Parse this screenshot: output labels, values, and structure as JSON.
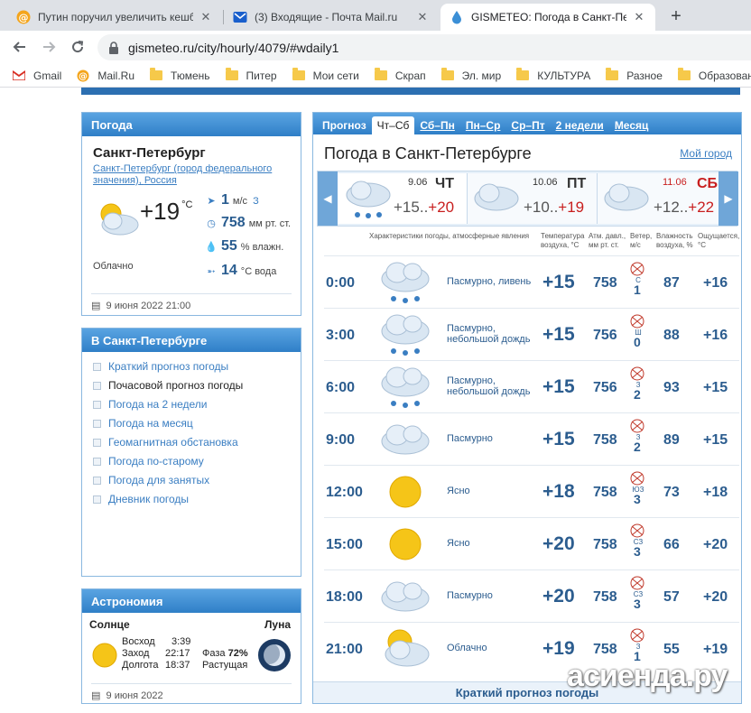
{
  "browser": {
    "tabs": [
      {
        "title": "Путин поручил увеличить кешб",
        "icon": "mailru-at-icon"
      },
      {
        "title": "(3) Входящие - Почта Mail.ru",
        "icon": "mail-envelope-icon"
      },
      {
        "title": "GISMETEO: Погода в Санкт-Пете",
        "icon": "gismeteo-drop-icon"
      }
    ],
    "url": "gismeteo.ru/city/hourly/4079/#wdaily1",
    "bookmarks": [
      "Gmail",
      "Mail.Ru",
      "Тюмень",
      "Питер",
      "Мои сети",
      "Скрап",
      "Эл. мир",
      "КУЛЬТУРА",
      "Разное",
      "Образован"
    ]
  },
  "weather_panel": {
    "title": "Погода",
    "city": "Санкт-Петербург",
    "region_link": "Санкт-Петербург (город федерального значения)",
    "country_link": "Россия",
    "temp": "+19",
    "temp_unit": "°C",
    "wind_value": "1",
    "wind_unit": "м/с",
    "wind_dir": "З",
    "pressure_value": "758",
    "pressure_unit": "мм рт. ст.",
    "humidity_value": "55",
    "humidity_unit": "% влажн.",
    "water_value": "14",
    "water_unit": "°С вода",
    "condition": "Облачно",
    "datetime": "9 июня 2022 21:00"
  },
  "city_menu": {
    "title": "В Санкт-Петербурге",
    "items": [
      "Краткий прогноз погоды",
      "Почасовой прогноз погоды",
      "Погода на 2 недели",
      "Погода на месяц",
      "Геомагнитная обстановка",
      "Погода по-старому",
      "Погода для занятых",
      "Дневник погоды"
    ]
  },
  "astronomy": {
    "title": "Астрономия",
    "sun_label": "Солнце",
    "moon_label": "Луна",
    "sunrise_label": "Восход",
    "sunrise": "3:39",
    "sunset_label": "Заход",
    "sunset": "22:17",
    "daylength_label": "Долгота",
    "daylength": "18:37",
    "phase_label": "Фаза",
    "phase": "72%",
    "moon_state": "Растущая",
    "date": "9 июня 2022"
  },
  "forecast": {
    "tabs": [
      "Прогноз",
      "Чт–Сб",
      "Сб–Пн",
      "Пн–Ср",
      "Ср–Пт",
      "2 недели",
      "Месяц"
    ],
    "title": "Погода в Санкт-Петербурге",
    "my_city": "Мой город",
    "days": [
      {
        "date": "9.06",
        "dow": "ЧТ",
        "lo": "+15",
        "hi": "+20"
      },
      {
        "date": "10.06",
        "dow": "ПТ",
        "lo": "+10",
        "hi": "+19"
      },
      {
        "date": "11.06",
        "dow": "СБ",
        "lo": "+12",
        "hi": "+22"
      }
    ],
    "columns": {
      "desc": "Характеристики погоды, атмосферные явления",
      "temp": "Температура воздуха, °C",
      "press": "Атм. давл., мм рт. ст.",
      "wind": "Ветер, м/с",
      "hum": "Влажность воздуха, %",
      "feel": "Ощущается, °C"
    },
    "rows": [
      {
        "time": "0:00",
        "desc": "Пасмурно, ливень",
        "temp": "+15",
        "press": "758",
        "wind_dir": "С",
        "wind": "1",
        "hum": "87",
        "feel": "+16",
        "icon": "cloud-rain-icon"
      },
      {
        "time": "3:00",
        "desc": "Пасмурно, небольшой дождь",
        "temp": "+15",
        "press": "756",
        "wind_dir": "Ш",
        "wind": "0",
        "hum": "88",
        "feel": "+16",
        "icon": "cloud-rain-icon"
      },
      {
        "time": "6:00",
        "desc": "Пасмурно, небольшой дождь",
        "temp": "+15",
        "press": "756",
        "wind_dir": "З",
        "wind": "2",
        "hum": "93",
        "feel": "+15",
        "icon": "cloud-rain-icon"
      },
      {
        "time": "9:00",
        "desc": "Пасмурно",
        "temp": "+15",
        "press": "758",
        "wind_dir": "З",
        "wind": "2",
        "hum": "89",
        "feel": "+15",
        "icon": "cloud-icon"
      },
      {
        "time": "12:00",
        "desc": "Ясно",
        "temp": "+18",
        "press": "758",
        "wind_dir": "ЮЗ",
        "wind": "3",
        "hum": "73",
        "feel": "+18",
        "icon": "sun-icon"
      },
      {
        "time": "15:00",
        "desc": "Ясно",
        "temp": "+20",
        "press": "758",
        "wind_dir": "СЗ",
        "wind": "3",
        "hum": "66",
        "feel": "+20",
        "icon": "sun-icon"
      },
      {
        "time": "18:00",
        "desc": "Пасмурно",
        "temp": "+20",
        "press": "758",
        "wind_dir": "СЗ",
        "wind": "3",
        "hum": "57",
        "feel": "+20",
        "icon": "cloud-icon"
      },
      {
        "time": "21:00",
        "desc": "Облачно",
        "temp": "+19",
        "press": "758",
        "wind_dir": "З",
        "wind": "1",
        "hum": "55",
        "feel": "+19",
        "icon": "sun-cloud-icon"
      }
    ],
    "brief_link": "Краткий прогноз погоды"
  },
  "watermark": "асиенда.ру",
  "colors": {
    "brand_blue": "#2f7fc7",
    "link": "#3a7ec2",
    "hot": "#c81e1e",
    "value_blue": "#2c5d8f"
  }
}
